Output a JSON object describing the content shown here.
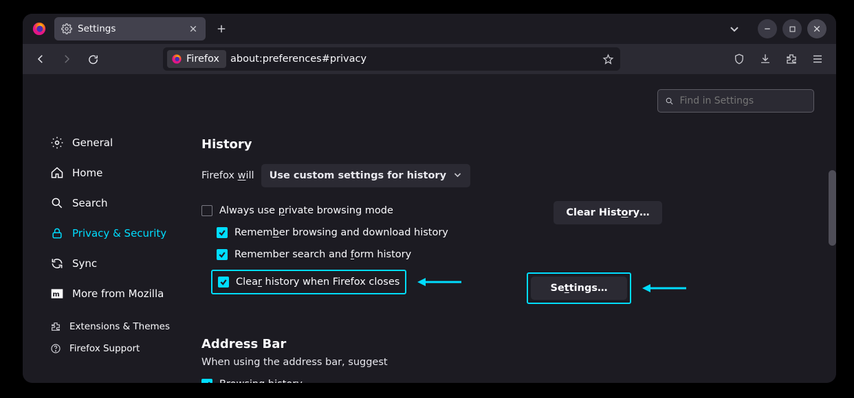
{
  "tab": {
    "label": "Settings"
  },
  "url": {
    "identity": "Firefox",
    "path": "about:preferences#privacy"
  },
  "search": {
    "placeholder": "Find in Settings"
  },
  "sidebar": {
    "items": [
      {
        "label": "General"
      },
      {
        "label": "Home"
      },
      {
        "label": "Search"
      },
      {
        "label": "Privacy & Security"
      },
      {
        "label": "Sync"
      },
      {
        "label": "More from Mozilla"
      }
    ],
    "sub": [
      {
        "label": "Extensions & Themes"
      },
      {
        "label": "Firefox Support"
      }
    ]
  },
  "history": {
    "heading": "History",
    "will_prefix": "Firefox ",
    "will_word_pre": "w",
    "will_word_post": "ill",
    "select_value": "Use custom settings for history",
    "always_private_pre": "Always use ",
    "always_private_u": "p",
    "always_private_post": "rivate browsing mode",
    "remember_browse_pre": "Remem",
    "remember_browse_u": "b",
    "remember_browse_post": "er browsing and download history",
    "remember_form_pre": "Remember search and ",
    "remember_form_u": "f",
    "remember_form_post": "orm history",
    "clear_close_pre": "Clea",
    "clear_close_u": "r",
    "clear_close_post": " history when Firefox closes",
    "clear_btn_pre": "Clear Hist",
    "clear_btn_u": "o",
    "clear_btn_post": "ry…",
    "settings_btn_pre": "Se",
    "settings_btn_u": "t",
    "settings_btn_post": "tings…"
  },
  "addressbar": {
    "heading": "Address Bar",
    "sub": "When using the address bar, suggest",
    "browsing_pre": "Browsing ",
    "browsing_u": "h",
    "browsing_post": "istory"
  }
}
